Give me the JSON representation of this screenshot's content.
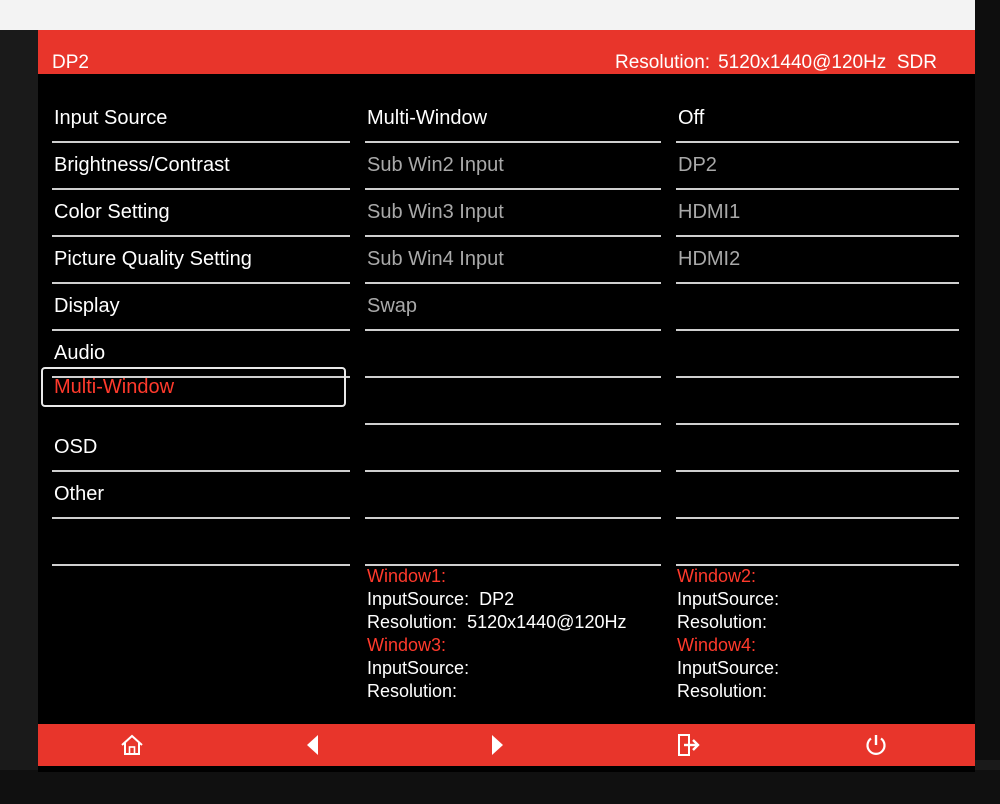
{
  "header": {
    "input": "DP2",
    "resolution_label": "Resolution:",
    "resolution_value": "5120x1440@120Hz",
    "dynamic_range": "SDR"
  },
  "menu": {
    "items": [
      {
        "label": "Input Source"
      },
      {
        "label": "Brightness/Contrast"
      },
      {
        "label": "Color Setting"
      },
      {
        "label": "Picture Quality Setting"
      },
      {
        "label": "Display"
      },
      {
        "label": "Audio"
      },
      {
        "label": "Multi-Window",
        "selected": true
      },
      {
        "label": "OSD"
      },
      {
        "label": "Other"
      }
    ]
  },
  "submenu": {
    "items": [
      {
        "label": "Multi-Window"
      },
      {
        "label": "Sub Win2 Input"
      },
      {
        "label": "Sub Win3 Input"
      },
      {
        "label": "Sub Win4 Input"
      },
      {
        "label": "Swap"
      }
    ]
  },
  "values": {
    "items": [
      {
        "label": "Off"
      },
      {
        "label": "DP2"
      },
      {
        "label": "HDMI1"
      },
      {
        "label": "HDMI2"
      }
    ]
  },
  "windows": {
    "w1": {
      "title": "Window1:",
      "input_label": "InputSource:",
      "input_value": "DP2",
      "res_label": "Resolution:",
      "res_value": "5120x1440@120Hz"
    },
    "w2": {
      "title": "Window2:",
      "input_label": "InputSource:",
      "input_value": "",
      "res_label": "Resolution:",
      "res_value": ""
    },
    "w3": {
      "title": "Window3:",
      "input_label": "InputSource:",
      "input_value": "",
      "res_label": "Resolution:",
      "res_value": ""
    },
    "w4": {
      "title": "Window4:",
      "input_label": "InputSource:",
      "input_value": "",
      "res_label": "Resolution:",
      "res_value": ""
    }
  },
  "footer": {
    "icons": [
      "home-icon",
      "left-arrow-icon",
      "right-arrow-icon",
      "exit-icon",
      "power-icon"
    ]
  },
  "colors": {
    "accent": "#e8352b",
    "highlight_text": "#ff3a2c",
    "background": "#000000"
  }
}
